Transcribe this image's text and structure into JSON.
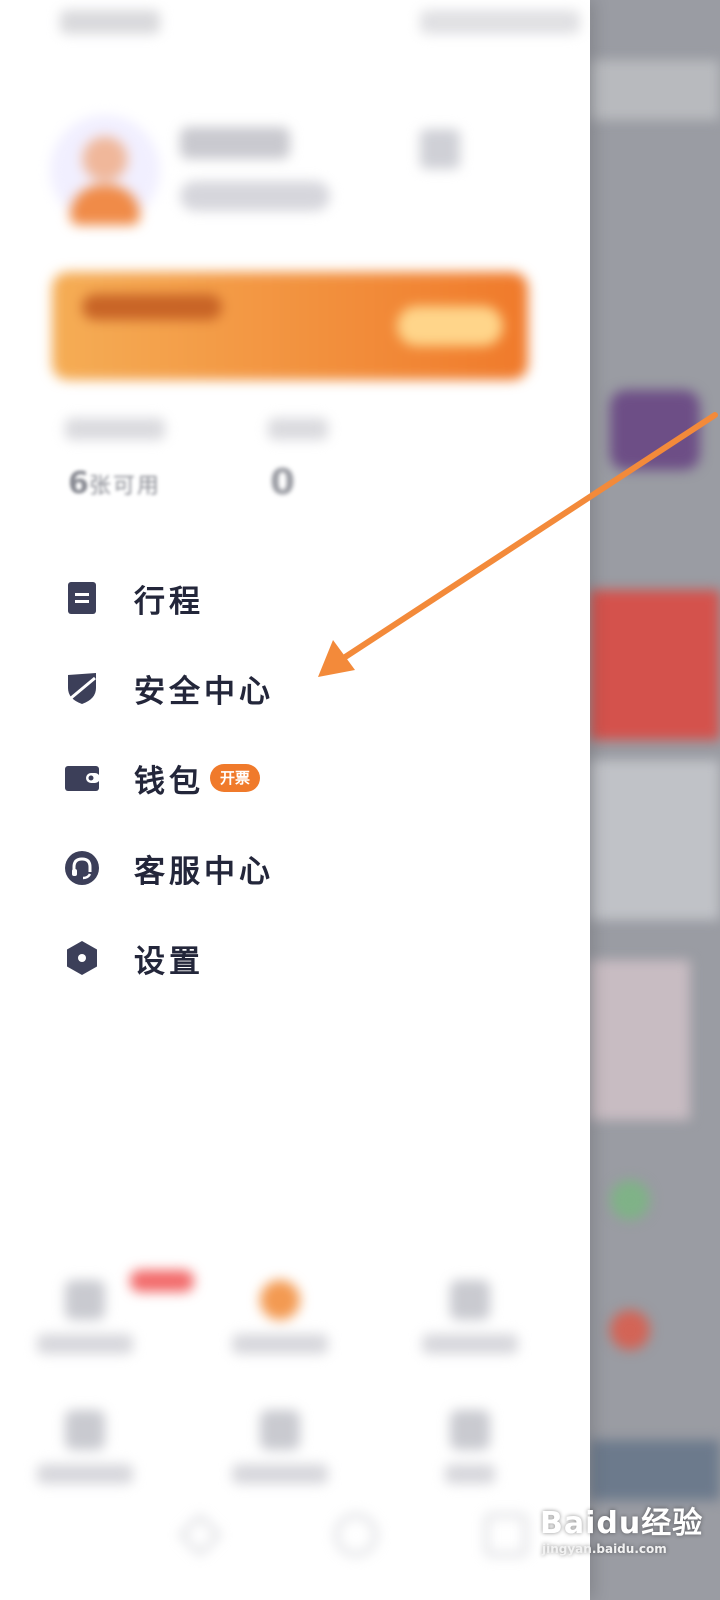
{
  "menu": {
    "items": [
      {
        "label": "行程",
        "icon": "document-icon"
      },
      {
        "label": "安全中心",
        "icon": "shield-icon"
      },
      {
        "label": "钱包",
        "icon": "wallet-icon",
        "tag": "开票"
      },
      {
        "label": "客服中心",
        "icon": "headset-icon"
      },
      {
        "label": "设置",
        "icon": "gear-icon"
      }
    ]
  },
  "stats": {
    "coupon_count": "6",
    "coupon_unit": "张可用",
    "balance": "0"
  },
  "watermark": {
    "brand": "Baidu经验",
    "url": "jingyan.baidu.com"
  },
  "colors": {
    "accent_orange": "#f07a2b",
    "arrow_orange": "#f38a3a",
    "icon_dark": "#3c3f59",
    "text_dark": "#23263a"
  }
}
